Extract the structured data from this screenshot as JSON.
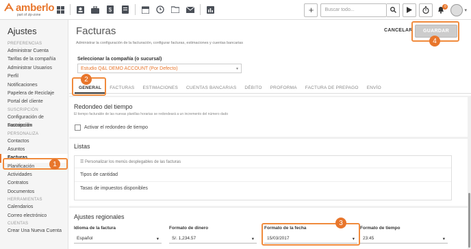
{
  "brand": {
    "name": "amberlo",
    "sub": "part of zip-zone",
    "color": "#e8762c"
  },
  "topbar": {
    "icons": [
      "dashboard-icon",
      "contacts-icon",
      "briefcase-icon",
      "billing-icon",
      "documents-icon",
      "calendar-icon",
      "history-icon",
      "folder-icon",
      "mail-icon",
      "reports-icon"
    ],
    "add_label": "+",
    "search_placeholder": "Buscar todo...",
    "notification_count": "0"
  },
  "sidebar": {
    "title": "Ajustes",
    "sections": [
      {
        "title": "PREFERENCIAS",
        "items": [
          "Administrar Cuenta",
          "Tarifas de la compañía",
          "Administrar Usuarios",
          "Perfil",
          "Notificaciones",
          "Papelera de Reciclaje",
          "Portal del cliente"
        ]
      },
      {
        "title": "SUSCRIPCIÓN",
        "items": [
          "Configuración de suscripción",
          "Facturación"
        ]
      },
      {
        "title": "PERSONALIZA",
        "items": [
          "Contactos",
          "Asuntos",
          "Facturas",
          "Planificación",
          "Actividades",
          "Contratos",
          "Documentos"
        ]
      },
      {
        "title": "HERRAMIENTAS",
        "items": [
          "Calendarios",
          "Correo electrónico"
        ]
      },
      {
        "title": "CUENTAS",
        "items": [
          "Crear Una Nueva Cuenta"
        ]
      }
    ],
    "active_item": "Facturas"
  },
  "main": {
    "title": "Facturas",
    "subtitle": "Administrar la configuración de la facturación, configurar facturas, estimaciones y cuentas bancarias",
    "cancel_label": "CANCELAR",
    "save_label": "GUARDAR",
    "company_label": "Seleccionar la compañía (o sucursal)",
    "company_value": "Estudio Q&L DEMO ACCOUNT (Por Defecto)",
    "tabs": [
      "GENERAL",
      "FACTURAS",
      "ESTIMACIONES",
      "CUENTAS BANCARIAS",
      "DÉBITO",
      "PROFORMA",
      "FACTURA DE PREPAGO",
      "ENVÍO"
    ],
    "rounding": {
      "title": "Redondeo del tiempo",
      "subtitle": "El tiempo facturable de las nuevas planillas horarias se redondeará a un incremento del número dado",
      "checkbox_label": "Activar el redondeo de tiempo"
    },
    "lists": {
      "title": "Listas",
      "hint": "Personalizar los menús desplegables de las facturas",
      "rows": [
        "Tipos de cantidad",
        "Tasas de impuestos disponibles"
      ]
    },
    "regional": {
      "title": "Ajustes regionales",
      "fields": [
        {
          "label": "Idioma de la factura",
          "value": "Español"
        },
        {
          "label": "Formato de dinero",
          "value": "S/. 1,234.57"
        },
        {
          "label": "Formato de la fecha",
          "value": "15/03/2017"
        },
        {
          "label": "Formato de tiempo",
          "value": "23:45"
        }
      ]
    }
  },
  "markers": [
    "1",
    "2",
    "3",
    "4"
  ]
}
